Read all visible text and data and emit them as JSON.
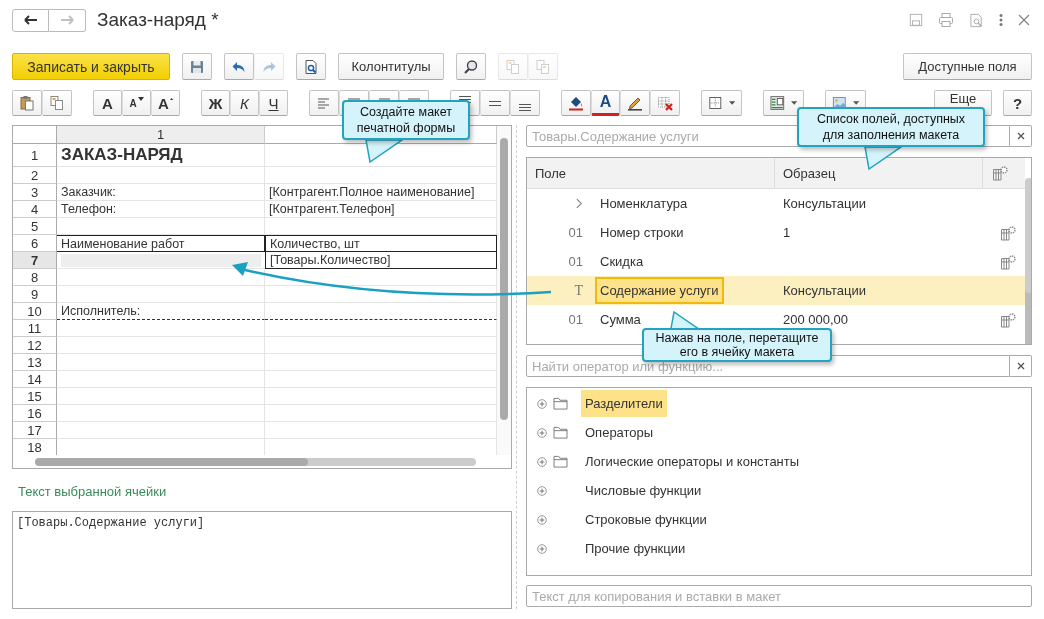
{
  "window": {
    "title": "Заказ-наряд *",
    "forward_disabled": true
  },
  "toolbar_1": [
    [
      {
        "kind": "primary",
        "label": "Записать и закрыть",
        "disabled": false
      }
    ],
    [
      {
        "kind": "save",
        "disabled": false
      }
    ],
    [
      {
        "kind": "undo",
        "disabled": false
      },
      {
        "kind": "redo",
        "disabled": true
      }
    ],
    [
      {
        "kind": "preview",
        "disabled": false
      }
    ],
    [
      {
        "kind": "text",
        "label": "Колонтитулы",
        "disabled": false
      }
    ],
    [
      {
        "kind": "find",
        "disabled": false
      }
    ],
    [
      {
        "kind": "copy",
        "disabled": true
      },
      {
        "kind": "copyall",
        "disabled": true
      }
    ]
  ],
  "toolbar_1_right": [
    {
      "kind": "text",
      "label": "Доступные поля",
      "disabled": false
    }
  ],
  "toolbar_2": [
    [
      {
        "kind": "paste"
      },
      {
        "kind": "copy"
      }
    ],
    [
      {
        "kind": "font",
        "label": "A"
      },
      {
        "kind": "shrink",
        "label": "A"
      },
      {
        "kind": "grow",
        "label": "A"
      }
    ],
    [
      {
        "kind": "bold",
        "label": "Ж"
      },
      {
        "kind": "italic",
        "label": "К"
      },
      {
        "kind": "underline",
        "label": "Ч"
      }
    ],
    [
      {
        "kind": "alignleft"
      },
      {
        "kind": "aligncenter"
      },
      {
        "kind": "alignright"
      },
      {
        "kind": "justify"
      }
    ],
    [
      {
        "kind": "valigntop"
      },
      {
        "kind": "valignmiddle"
      },
      {
        "kind": "valignbottom"
      }
    ],
    [
      {
        "kind": "fill"
      },
      {
        "kind": "fontcolor",
        "label": "A"
      },
      {
        "kind": "pen"
      },
      {
        "kind": "clear"
      }
    ],
    [
      {
        "kind": "borders"
      }
    ],
    [
      {
        "kind": "layout"
      }
    ],
    [
      {
        "kind": "picture"
      }
    ]
  ],
  "toolbar_2_right": [
    {
      "kind": "text",
      "label": "Еще"
    },
    {
      "kind": "help",
      "label": "?"
    }
  ],
  "sheet": {
    "columns": [
      "1"
    ],
    "rows": [
      {
        "number": "1",
        "kind": "title",
        "col_1": "ЗАКАЗ-НАРЯД",
        "selected": false
      },
      {
        "number": "2",
        "kind": "plain",
        "selected": false
      },
      {
        "number": "3",
        "kind": "plain",
        "col_1": "Заказчик:",
        "col_2": "[Контрагент.Полное наименование]",
        "selected": false
      },
      {
        "number": "4",
        "kind": "plain",
        "col_1": "Телефон:",
        "col_2": "[Контрагент.Телефон]",
        "selected": false
      },
      {
        "number": "5",
        "kind": "plain",
        "selected": false
      },
      {
        "number": "6",
        "kind": "table",
        "col_1": "Наименование работ",
        "col_2": "Количество, шт",
        "selected": false
      },
      {
        "number": "7",
        "kind": "table",
        "col_2": "[Товары.Количество]",
        "selected": true
      },
      {
        "number": "8",
        "kind": "plain",
        "selected": false
      },
      {
        "number": "9",
        "kind": "plain",
        "selected": false
      },
      {
        "number": "10",
        "kind": "signature",
        "col_1": "Исполнитель:",
        "selected": false
      },
      {
        "number": "11",
        "kind": "plain",
        "selected": false
      },
      {
        "number": "12",
        "kind": "plain",
        "selected": false
      },
      {
        "number": "13",
        "kind": "plain",
        "selected": false
      },
      {
        "number": "14",
        "kind": "plain",
        "selected": false
      },
      {
        "number": "15",
        "kind": "plain",
        "selected": false
      },
      {
        "number": "16",
        "kind": "plain",
        "selected": false
      },
      {
        "number": "17",
        "kind": "plain",
        "selected": false
      },
      {
        "number": "18",
        "kind": "plain",
        "selected": false
      }
    ]
  },
  "cell_text": {
    "label": "Текст выбранной ячейки",
    "value": "[Товары.Содержание услуги]"
  },
  "fields": {
    "search": {
      "placeholder": "Товары.Содержание услуги"
    },
    "columns": [
      "Поле",
      "Образец"
    ],
    "rows": [
      {
        "kind": "group",
        "name": "Номенклатура",
        "sample": "Консультации",
        "format_button": false,
        "selected": false
      },
      {
        "kind": "field",
        "mark": "01",
        "name": "Номер строки",
        "sample": "1",
        "format_button": true,
        "selected": false
      },
      {
        "kind": "field",
        "mark": "01",
        "name": "Скидка",
        "format_button": true,
        "selected": false
      },
      {
        "kind": "field",
        "mark": "T",
        "name": "Содержание услуги",
        "sample": "Консультации",
        "format_button": false,
        "selected": true
      },
      {
        "kind": "field",
        "mark": "01",
        "name": "Сумма",
        "sample": "200 000,00",
        "format_button": true,
        "selected": false
      }
    ]
  },
  "functions": {
    "search": {
      "placeholder": "Найти оператор или функцию..."
    },
    "items": [
      {
        "label": "Разделители",
        "folder": true,
        "selected": true
      },
      {
        "label": "Операторы",
        "folder": true,
        "selected": false
      },
      {
        "label": "Логические операторы и константы",
        "folder": true,
        "selected": false
      },
      {
        "label": "Числовые функции",
        "folder": false,
        "selected": false
      },
      {
        "label": "Строковые функции",
        "folder": false,
        "selected": false
      },
      {
        "label": "Прочие функции",
        "folder": false,
        "selected": false
      }
    ]
  },
  "paste_text": {
    "placeholder": "Текст для копирования и вставки в макет"
  },
  "callouts": [
    {
      "text": "Создайте макет печатной формы"
    },
    {
      "text": "Список полей, доступных для заполнения макета"
    },
    {
      "text": "Нажав на поле, перетащите его в ячейку макета"
    }
  ]
}
